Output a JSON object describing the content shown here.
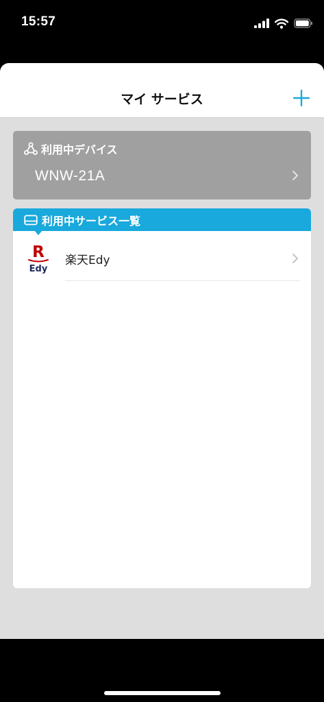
{
  "status_bar": {
    "time": "15:57",
    "icons": [
      "signal-icon",
      "wifi-icon",
      "battery-icon"
    ]
  },
  "nav": {
    "title": "マイ サービス",
    "add_icon": "plus-icon"
  },
  "device": {
    "header_label": "利用中デバイス",
    "header_icon": "device-network-icon",
    "name": "WNW-21A"
  },
  "services": {
    "header_label": "利用中サービス一覧",
    "header_icon": "card-icon",
    "items": [
      {
        "logo_letter": "R",
        "logo_text": "Edy",
        "name": "楽天Edy"
      }
    ]
  },
  "toolbar": {
    "left_icon": "refresh-icon",
    "right_icon": "list-menu-icon"
  },
  "colors": {
    "accent": "#19a9dc",
    "device_card": "#a0a0a0",
    "background": "#dedede",
    "rakuten_red": "#bf0000",
    "edy_navy": "#1c2a5a"
  }
}
